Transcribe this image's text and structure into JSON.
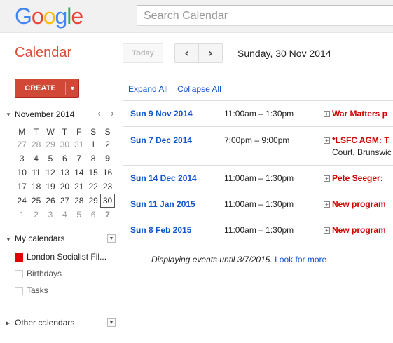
{
  "logo": {
    "letters": [
      "G",
      "o",
      "o",
      "g",
      "l",
      "e"
    ]
  },
  "search": {
    "placeholder": "Search Calendar"
  },
  "app": {
    "title": "Calendar"
  },
  "toolbar": {
    "today_label": "Today",
    "prev_icon": "chevron-left-icon",
    "next_icon": "chevron-right-icon",
    "current_date": "Sunday, 30 Nov 2014"
  },
  "create": {
    "label": "CREATE"
  },
  "mini_calendar": {
    "title": "November 2014",
    "dow": [
      "M",
      "T",
      "W",
      "T",
      "F",
      "S",
      "S"
    ],
    "weeks": [
      [
        "27",
        "28",
        "29",
        "30",
        "31",
        "1",
        "2"
      ],
      [
        "3",
        "4",
        "5",
        "6",
        "7",
        "8",
        "9"
      ],
      [
        "10",
        "11",
        "12",
        "13",
        "14",
        "15",
        "16"
      ],
      [
        "17",
        "18",
        "19",
        "20",
        "21",
        "22",
        "23"
      ],
      [
        "24",
        "25",
        "26",
        "27",
        "28",
        "29",
        "30"
      ],
      [
        "1",
        "2",
        "3",
        "4",
        "5",
        "6",
        "7"
      ]
    ]
  },
  "my_calendars": {
    "label": "My calendars",
    "items": [
      {
        "label": "London Socialist Fil...",
        "checked": true,
        "color": "#e00000"
      },
      {
        "label": "Birthdays",
        "checked": false
      },
      {
        "label": "Tasks",
        "checked": false
      }
    ]
  },
  "other_calendars": {
    "label": "Other calendars"
  },
  "agenda": {
    "expand_all": "Expand All",
    "collapse_all": "Collapse All",
    "events": [
      {
        "date": "Sun 9 Nov 2014",
        "time": "11:00am – 1:30pm",
        "title": "War Matters p",
        "sub": ""
      },
      {
        "date": "Sun 7 Dec 2014",
        "time": "7:00pm – 9:00pm",
        "title": "*LSFC AGM: T",
        "sub": "Court, Brunswic"
      },
      {
        "date": "Sun 14 Dec 2014",
        "time": "11:00am – 1:30pm",
        "title": "Pete Seeger:",
        "sub": ""
      },
      {
        "date": "Sun 11 Jan 2015",
        "time": "11:00am – 1:30pm",
        "title": "New program",
        "sub": ""
      },
      {
        "date": "Sun 8 Feb 2015",
        "time": "11:00am – 1:30pm",
        "title": "New program",
        "sub": ""
      }
    ],
    "footer_text": "Displaying events until 3/7/2015.",
    "footer_link": "Look for more"
  }
}
